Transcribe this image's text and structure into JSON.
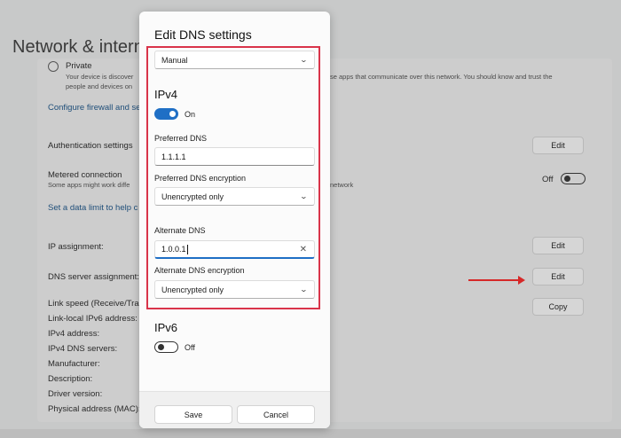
{
  "background": {
    "title": "Network & intern",
    "private_label": "Private",
    "private_desc_line1": "Your device is discover",
    "private_desc_right": "se apps that communicate over this network. You should know and trust the",
    "private_desc_line2": "people and devices on",
    "firewall_link": "Configure firewall and se",
    "auth_label": "Authentication settings",
    "auth_button": "Edit",
    "metered_label": "Metered connection",
    "metered_desc": "Some apps might work diffe",
    "metered_desc_right": "network",
    "metered_state": "Off",
    "data_limit_link": "Set a data limit to help c",
    "ip_label": "IP assignment:",
    "ip_button": "Edit",
    "dns_label": "DNS server assignment:",
    "dns_button": "Edit",
    "link_speed": "Link speed (Receive/Tran",
    "copy_button": "Copy",
    "ipv6_local": "Link-local IPv6 address:",
    "ipv4_addr": "IPv4 address:",
    "ipv4_dns": "IPv4 DNS servers:",
    "manufacturer": "Manufacturer:",
    "description": "Description:",
    "driver": "Driver version:",
    "mac": "Physical address (MAC):"
  },
  "dialog": {
    "title": "Edit DNS settings",
    "mode_select": "Manual",
    "ipv4_heading": "IPv4",
    "ipv4_toggle_state": "On",
    "preferred_dns_label": "Preferred DNS",
    "preferred_dns_value": "1.1.1.1",
    "preferred_enc_label": "Preferred DNS encryption",
    "preferred_enc_value": "Unencrypted only",
    "alternate_dns_label": "Alternate DNS",
    "alternate_dns_value": "1.0.0.1",
    "alternate_enc_label": "Alternate DNS encryption",
    "alternate_enc_value": "Unencrypted only",
    "ipv6_heading": "IPv6",
    "ipv6_toggle_state": "Off",
    "save_label": "Save",
    "cancel_label": "Cancel"
  },
  "colors": {
    "accent": "#1f6fc5",
    "highlight": "#d9344a",
    "arrow": "#d62828"
  }
}
